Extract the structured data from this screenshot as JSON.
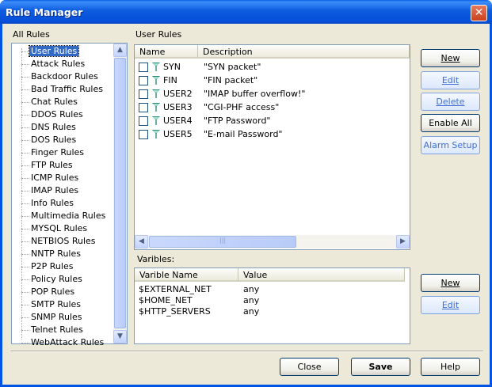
{
  "window": {
    "title": "Rule Manager"
  },
  "all_rules": {
    "label": "All Rules",
    "items": [
      "User Rules",
      "Attack Rules",
      "Backdoor Rules",
      "Bad Traffic Rules",
      "Chat Rules",
      "DDOS Rules",
      "DNS Rules",
      "DOS Rules",
      "Finger Rules",
      "FTP Rules",
      "ICMP Rules",
      "IMAP Rules",
      "Info Rules",
      "Multimedia Rules",
      "MYSQL Rules",
      "NETBIOS Rules",
      "NNTP Rules",
      "P2P Rules",
      "Policy Rules",
      "POP Rules",
      "SMTP Rules",
      "SNMP Rules",
      "Telnet Rules",
      "WebAttack Rules"
    ]
  },
  "user_rules": {
    "label": "User Rules",
    "columns": [
      "Name",
      "Description"
    ],
    "rows": [
      {
        "name": "SYN",
        "description": "\"SYN packet\""
      },
      {
        "name": "FIN",
        "description": "\"FIN packet\""
      },
      {
        "name": "USER2",
        "description": "\"IMAP buffer overflow!\""
      },
      {
        "name": "USER3",
        "description": "\"CGI-PHF access\""
      },
      {
        "name": "USER4",
        "description": "\"FTP Password\""
      },
      {
        "name": "USER5",
        "description": "\"E-mail Password\""
      }
    ]
  },
  "variables": {
    "label": "Varibles:",
    "columns": [
      "Varible Name",
      "Value"
    ],
    "rows": [
      {
        "name": "$EXTERNAL_NET",
        "value": "any"
      },
      {
        "name": "$HOME_NET",
        "value": "any"
      },
      {
        "name": "$HTTP_SERVERS",
        "value": "any"
      }
    ]
  },
  "rule_buttons": {
    "new": "New",
    "edit": "Edit",
    "delete": "Delete",
    "enable_all": "Enable All",
    "alarm_setup": "Alarm Setup"
  },
  "var_buttons": {
    "new": "New",
    "edit": "Edit"
  },
  "footer": {
    "close": "Close",
    "save": "Save",
    "help": "Help"
  },
  "colors": {
    "selection": "#316ac5",
    "titlebar": "#0054e3",
    "flag": "#2f8a7a"
  }
}
